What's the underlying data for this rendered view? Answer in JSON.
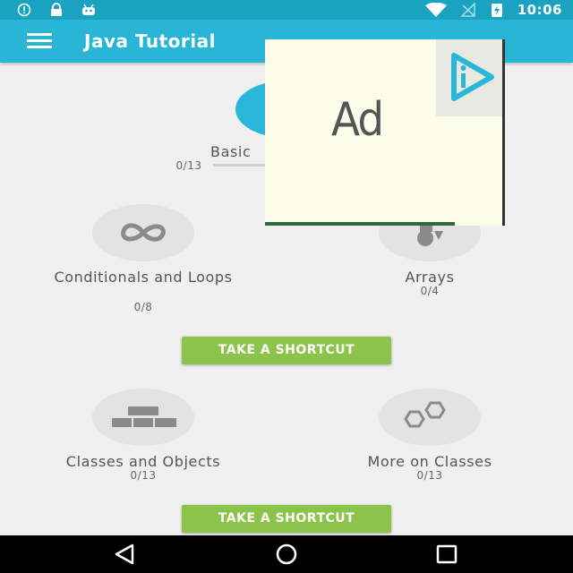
{
  "status_bar": {
    "time": "10:06",
    "icons": [
      "info-icon",
      "lock-icon",
      "android-icon",
      "wifi-icon",
      "no-signal-icon",
      "battery-icon"
    ]
  },
  "app_bar": {
    "title": "Java Tutorial",
    "menu_icon": "hamburger-menu-icon",
    "color": "#29b6d6"
  },
  "topics": [
    {
      "title": "Basics",
      "visible_title": "Basic",
      "count": "0/13",
      "icon": "code-icon",
      "accent": true
    },
    {
      "title": "Conditionals and Loops",
      "count": "0/8",
      "icon": "infinity-icon"
    },
    {
      "title": "Arrays",
      "count": "0/4",
      "icon": "shapes-icon"
    },
    {
      "title": "Classes and Objects",
      "count": "0/13",
      "icon": "blocks-icon"
    },
    {
      "title": "More on Classes",
      "count": "0/13",
      "icon": "hexagons-icon"
    }
  ],
  "shortcut_buttons": [
    {
      "label": "TAKE A SHORTCUT"
    },
    {
      "label": "TAKE A SHORTCUT"
    }
  ],
  "ad": {
    "label": "Ad",
    "icon": "ad-choices-icon"
  },
  "nav_bar": {
    "icons": [
      "back-icon",
      "home-icon",
      "recents-icon"
    ]
  },
  "colors": {
    "accent": "#2ab6d7",
    "button_green": "#8cc34a",
    "status_bar": "#1aa3c0"
  }
}
